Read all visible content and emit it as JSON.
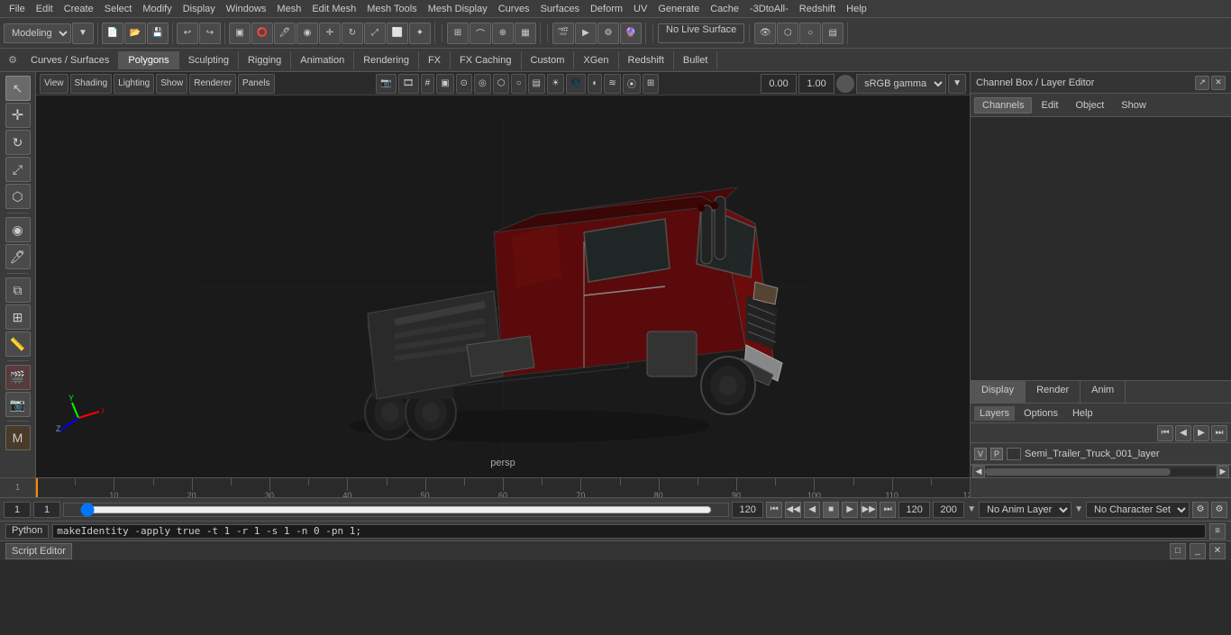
{
  "menubar": {
    "items": [
      "File",
      "Edit",
      "Create",
      "Select",
      "Modify",
      "Display",
      "Windows",
      "Mesh",
      "Edit Mesh",
      "Mesh Tools",
      "Mesh Display",
      "Curves",
      "Surfaces",
      "Deform",
      "UV",
      "Generate",
      "Cache",
      "-3DtoAll-",
      "Redshift",
      "Help"
    ]
  },
  "toolbar1": {
    "dropdown_label": "Modeling",
    "live_surface": "No Live Surface"
  },
  "tabbar": {
    "tabs": [
      "Curves / Surfaces",
      "Polygons",
      "Sculpting",
      "Rigging",
      "Animation",
      "Rendering",
      "FX",
      "FX Caching",
      "Custom",
      "XGen",
      "Redshift",
      "Bullet"
    ],
    "active": "Polygons"
  },
  "viewport": {
    "camera": "persp",
    "gamma": "sRGB gamma",
    "value1": "0.00",
    "value2": "1.00"
  },
  "rightpanel": {
    "title": "Channel Box / Layer Editor",
    "tabs": [
      "Channels",
      "Edit",
      "Object",
      "Show"
    ],
    "disp_tabs": [
      "Display",
      "Render",
      "Anim"
    ],
    "layers_tabs": [
      "Layers",
      "Options",
      "Help"
    ],
    "layer_name": "Semi_Trailer_Truck_001_layer",
    "layer_v": "V",
    "layer_p": "P"
  },
  "bottombar": {
    "frame_start": "1",
    "frame_end": "1",
    "range_end": "120",
    "playback_end": "120",
    "max_frame": "200",
    "anim_layer": "No Anim Layer",
    "char_set": "No Character Set"
  },
  "python": {
    "label": "Python",
    "command": "makeIdentity -apply true -t 1 -r 1 -s 1 -n 0 -pn 1;"
  },
  "scripttab": {
    "label": "Script Editor"
  },
  "lefttoolbar": {
    "buttons": [
      "↖",
      "↕",
      "↻",
      "⊕",
      "🔁",
      "⬛",
      "▣",
      "☰",
      "⧉",
      "🔲",
      "◉"
    ]
  }
}
